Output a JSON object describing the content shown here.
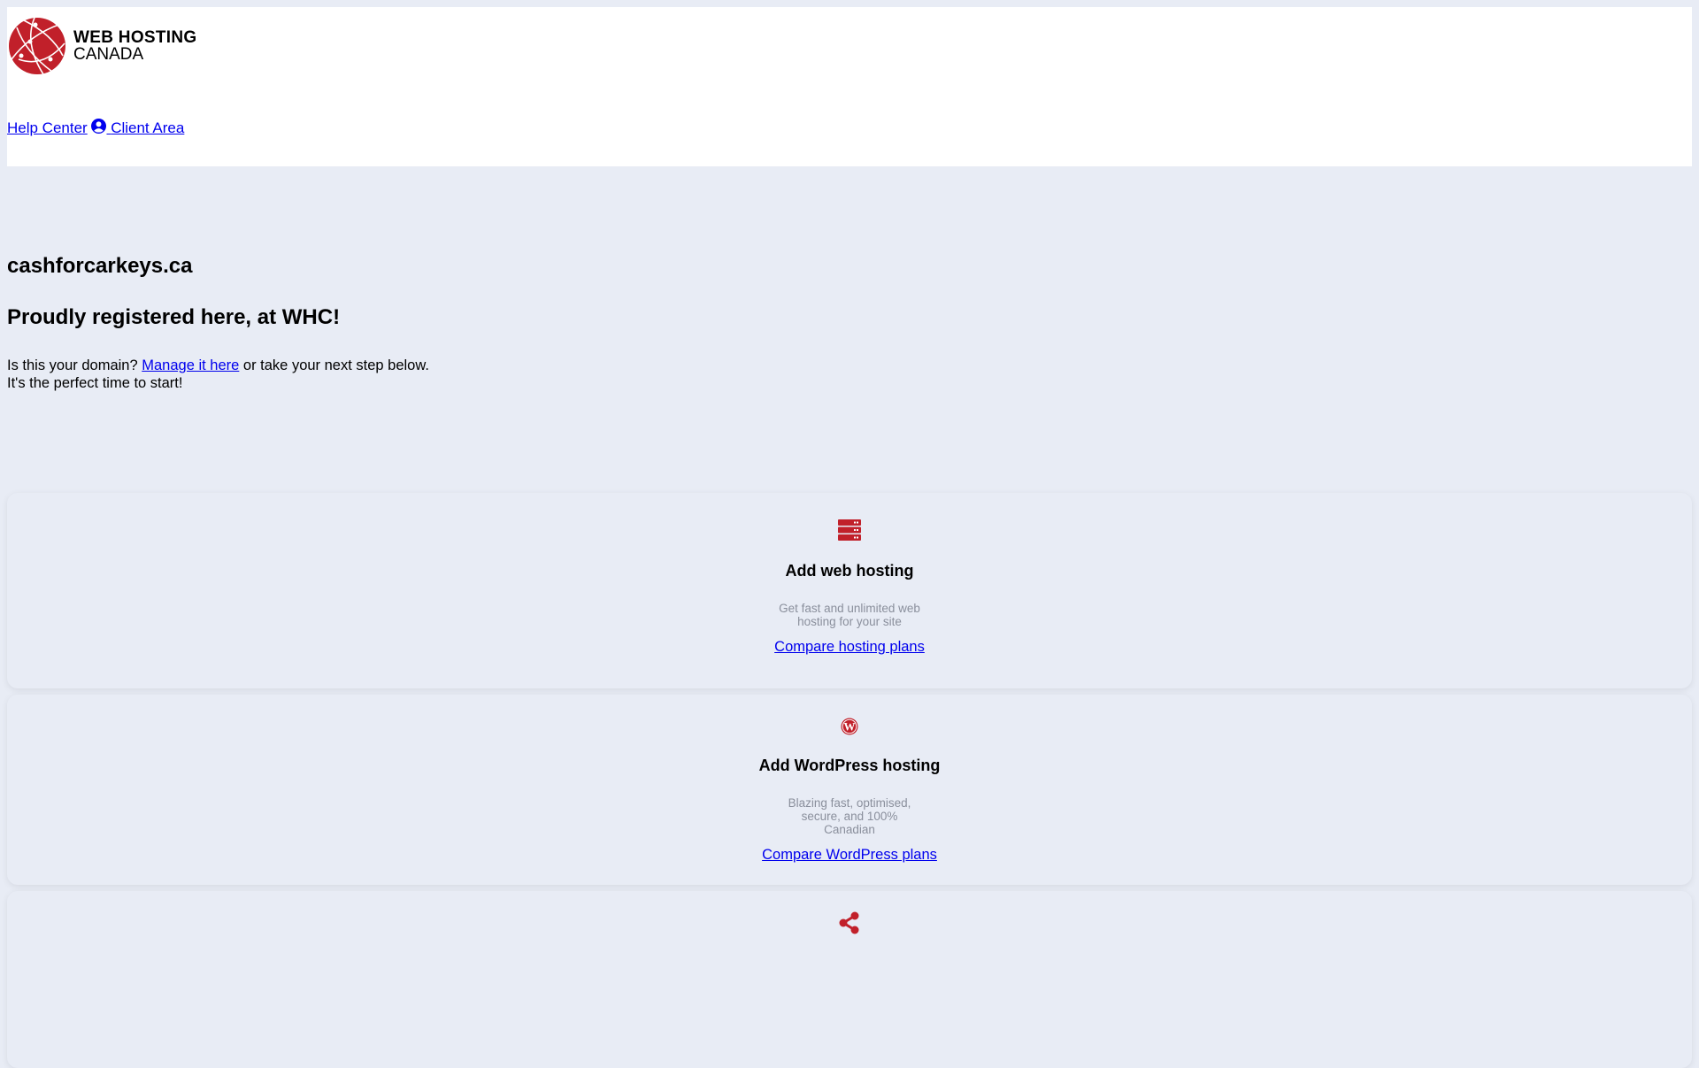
{
  "header": {
    "logo": {
      "line1": "WEB HOSTING",
      "line2": "CANADA"
    },
    "nav": {
      "help_center": "Help Center",
      "client_area": "Client Area"
    }
  },
  "main": {
    "domain": "cashforcarkeys.ca",
    "tagline": "Proudly registered here, at WHC!",
    "intro_before": "Is this your domain? ",
    "intro_link": "Manage it here",
    "intro_after": " or take your next step below. It's the perfect time to start!"
  },
  "cards": [
    {
      "icon": "server-icon",
      "title": "Add web hosting",
      "description": "Get fast and unlimited web hosting for your site",
      "link": "Compare hosting plans"
    },
    {
      "icon": "wordpress-icon",
      "title": "Add WordPress hosting",
      "description": "Blazing fast, optimised, secure, and 100% Canadian",
      "link": "Compare WordPress plans"
    },
    {
      "icon": "share-icon"
    }
  ],
  "colors": {
    "accent": "#c1202a",
    "background": "#e8ecf5",
    "link": "#0000ee"
  }
}
